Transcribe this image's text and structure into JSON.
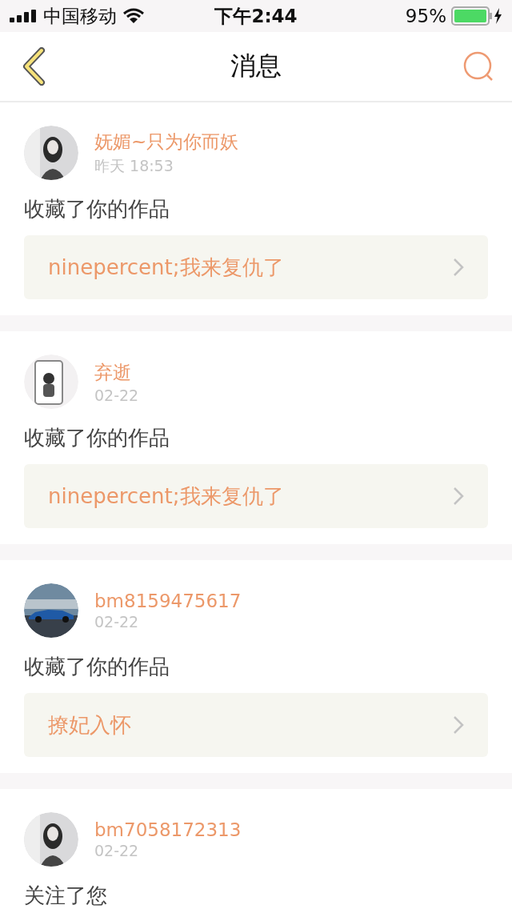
{
  "status_bar": {
    "carrier": "中国移动",
    "time": "下午2:44",
    "battery": "95%"
  },
  "nav": {
    "title": "消息"
  },
  "messages": [
    {
      "kind": "favorite",
      "user": "妩媚~只为你而妖",
      "time": "昨天 18:53",
      "action": "收藏了你的作品",
      "work": "ninepercent;我来复仇了"
    },
    {
      "kind": "favorite",
      "user": "弃逝",
      "time": "02-22",
      "action": "收藏了你的作品",
      "work": "ninepercent;我来复仇了"
    },
    {
      "kind": "favorite",
      "user": "bm8159475617",
      "time": "02-22",
      "action": "收藏了你的作品",
      "work": "撩妃入怀"
    },
    {
      "kind": "follow",
      "user": "bm7058172313",
      "time": "02-22",
      "action": "关注了您"
    }
  ]
}
